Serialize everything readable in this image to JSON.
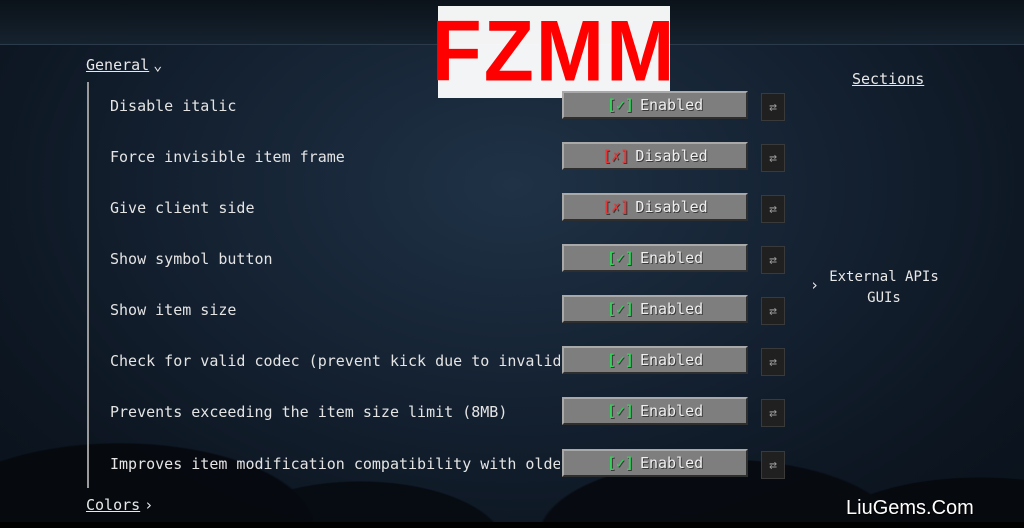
{
  "logo_text": "FZMM",
  "categories": {
    "general": {
      "label": "General",
      "chevron": "down"
    },
    "colors": {
      "label": "Colors",
      "chevron": "right"
    }
  },
  "options": [
    {
      "label": "Disable italic",
      "state": "Enabled",
      "enabled": true,
      "mark": "✓",
      "reset_icon": "⇄"
    },
    {
      "label": "Force invisible item frame",
      "state": "Disabled",
      "enabled": false,
      "mark": "✗",
      "reset_icon": "⇄"
    },
    {
      "label": "Give client side",
      "state": "Disabled",
      "enabled": false,
      "mark": "✗",
      "reset_icon": "⇄"
    },
    {
      "label": "Show symbol button",
      "state": "Enabled",
      "enabled": true,
      "mark": "✓",
      "reset_icon": "⇄"
    },
    {
      "label": "Show item size",
      "state": "Enabled",
      "enabled": true,
      "mark": "✓",
      "reset_icon": "⇄"
    },
    {
      "label": "Check for valid codec (prevent kick due to invalid item)",
      "state": "Enabled",
      "enabled": true,
      "mark": "✓",
      "reset_icon": "⇄"
    },
    {
      "label": "Prevents exceeding the item size limit (8MB)",
      "state": "Enabled",
      "enabled": true,
      "mark": "✓",
      "reset_icon": "⇄"
    },
    {
      "label": "Improves item modification compatibility with older versio",
      "state": "Enabled",
      "enabled": true,
      "mark": "✓",
      "reset_icon": "⇄"
    }
  ],
  "sections": {
    "title": "Sections",
    "entry_line1": "External APIs",
    "entry_line2": "GUIs"
  },
  "watermark": "LiuGems.Com",
  "colors": {
    "enabled_mark": "#35d05a",
    "disabled_mark": "#e23a3a",
    "logo_red": "#ff0000",
    "button_gray": "#7e7e7e"
  }
}
